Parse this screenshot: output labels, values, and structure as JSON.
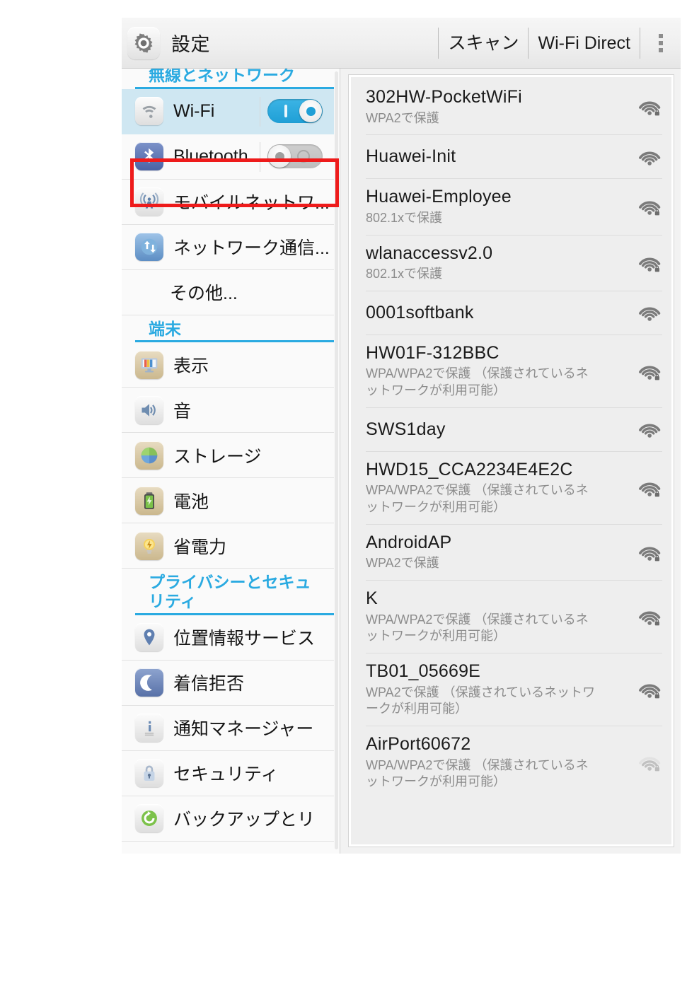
{
  "titlebar": {
    "icon": "settings-gear-icon",
    "title": "設定",
    "scan_label": "スキャン",
    "wifi_direct_label": "Wi-Fi Direct",
    "overflow_label": "overflow-menu-icon"
  },
  "sidebar": {
    "sections": [
      {
        "header": "無線とネットワーク",
        "items": [
          {
            "label": "Wi-Fi",
            "icon": "wifi-icon",
            "selected": true,
            "toggle": "on"
          },
          {
            "label": "Bluetooth",
            "icon": "bluetooth-icon",
            "selected": false,
            "toggle": "off"
          },
          {
            "label": "モバイルネットワ...",
            "icon": "cell-tower-icon",
            "selected": false,
            "toggle": "none",
            "highlighted": true
          },
          {
            "label": "ネットワーク通信...",
            "icon": "network-transfer-icon",
            "selected": false,
            "toggle": "none"
          },
          {
            "label": "その他...",
            "icon": "none",
            "selected": false,
            "toggle": "none"
          }
        ]
      },
      {
        "header": "端末",
        "items": [
          {
            "label": "表示",
            "icon": "display-icon",
            "selected": false,
            "toggle": "none"
          },
          {
            "label": "音",
            "icon": "sound-icon",
            "selected": false,
            "toggle": "none"
          },
          {
            "label": "ストレージ",
            "icon": "storage-icon",
            "selected": false,
            "toggle": "none"
          },
          {
            "label": "電池",
            "icon": "battery-icon",
            "selected": false,
            "toggle": "none"
          },
          {
            "label": "省電力",
            "icon": "power-saving-icon",
            "selected": false,
            "toggle": "none"
          }
        ]
      },
      {
        "header": "プライバシーとセキュリティ",
        "items": [
          {
            "label": "位置情報サービス",
            "icon": "location-pin-icon",
            "selected": false,
            "toggle": "none"
          },
          {
            "label": "着信拒否",
            "icon": "moon-icon",
            "selected": false,
            "toggle": "none"
          },
          {
            "label": "通知マネージャー",
            "icon": "info-icon",
            "selected": false,
            "toggle": "none"
          },
          {
            "label": "セキュリティ",
            "icon": "lock-icon",
            "selected": false,
            "toggle": "none"
          },
          {
            "label": "バックアップとリ",
            "icon": "backup-restore-icon",
            "selected": false,
            "toggle": "none"
          }
        ]
      }
    ]
  },
  "wifi_list": [
    {
      "ssid": "302HW-PocketWiFi",
      "security": "WPA2で保護",
      "secured": true,
      "signal": 4,
      "faded": false
    },
    {
      "ssid": "Huawei-Init",
      "security": "",
      "secured": false,
      "signal": 4,
      "faded": false
    },
    {
      "ssid": "Huawei-Employee",
      "security": "802.1xで保護",
      "secured": true,
      "signal": 4,
      "faded": false
    },
    {
      "ssid": "wlanaccessv2.0",
      "security": "802.1xで保護",
      "secured": true,
      "signal": 4,
      "faded": false
    },
    {
      "ssid": "0001softbank",
      "security": "",
      "secured": false,
      "signal": 4,
      "faded": false
    },
    {
      "ssid": "HW01F-312BBC",
      "security": "WPA/WPA2で保護 （保護されているネットワークが利用可能）",
      "secured": true,
      "signal": 4,
      "faded": false
    },
    {
      "ssid": "SWS1day",
      "security": "",
      "secured": false,
      "signal": 4,
      "faded": false
    },
    {
      "ssid": "HWD15_CCA2234E4E2C",
      "security": "WPA/WPA2で保護 （保護されているネットワークが利用可能）",
      "secured": true,
      "signal": 4,
      "faded": false
    },
    {
      "ssid": "AndroidAP",
      "security": "WPA2で保護",
      "secured": true,
      "signal": 4,
      "faded": false
    },
    {
      "ssid": "K",
      "security": "WPA/WPA2で保護 （保護されているネットワークが利用可能）",
      "secured": true,
      "signal": 4,
      "faded": false
    },
    {
      "ssid": "TB01_05669E",
      "security": "WPA2で保護 （保護されているネットワークが利用可能）",
      "secured": true,
      "signal": 4,
      "faded": false
    },
    {
      "ssid": "AirPort60672",
      "security": "WPA/WPA2で保護 （保護されているネットワークが利用可能）",
      "secured": true,
      "signal": 3,
      "faded": true
    }
  ],
  "colors": {
    "accent_blue": "#2aaae1",
    "selected_row": "#cfe7f2",
    "annotation_red": "#ee1b1b",
    "toggle_on": "#1f9fd6",
    "panel_bg": "#eeeeee"
  }
}
